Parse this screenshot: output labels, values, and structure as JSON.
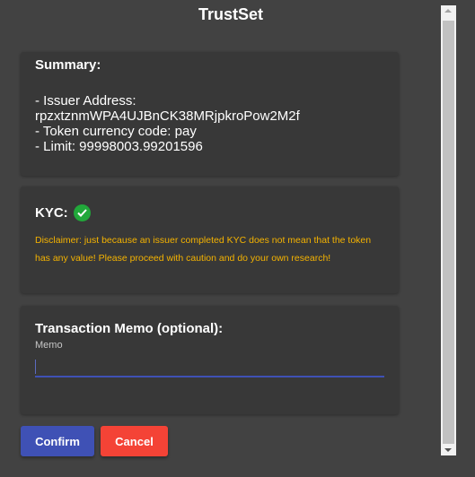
{
  "window": {
    "title": "TrustSet"
  },
  "summary": {
    "heading": "Summary:",
    "issuer_label": "- Issuer Address:",
    "issuer_address": "rpzxtznmWPA4UJBnCK38MRjpkroPow2M2f",
    "currency_line": "- Token currency code: pay",
    "limit_line": "- Limit: 99998003.99201596"
  },
  "kyc": {
    "heading": "KYC:",
    "status_icon": "check-circle-icon",
    "status_color": "#21a83a",
    "disclaimer": "Disclaimer: just because an issuer completed KYC does not mean that the token has any value! Please proceed with caution and do your own research!",
    "disclaimer_color": "#f5b301"
  },
  "memo": {
    "heading": "Transaction Memo (optional):",
    "field_label": "Memo",
    "value": "",
    "accent_color": "#3f51b5"
  },
  "actions": {
    "confirm_label": "Confirm",
    "confirm_color": "#3f51b5",
    "cancel_label": "Cancel",
    "cancel_color": "#f44336"
  }
}
